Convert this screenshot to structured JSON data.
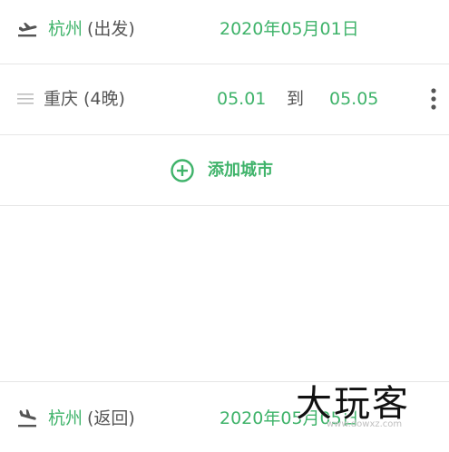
{
  "departure": {
    "city": "杭州",
    "tag": "(出发)",
    "date": "2020年05月01日"
  },
  "stop": {
    "city": "重庆",
    "nights": "(4晚)",
    "start": "05.01",
    "to": "到",
    "end": "05.05"
  },
  "add_city": {
    "label": "添加城市"
  },
  "return_trip": {
    "city": "杭州",
    "tag": "(返回)",
    "date": "2020年05月05日"
  },
  "watermark": {
    "logo_text": "大玩客",
    "small_text": "www.dowxz.com"
  },
  "colors": {
    "accent": "#3fb36a",
    "text": "#555555",
    "divider": "#e6e6e6"
  },
  "icons": {
    "departure": "plane-takeoff-icon",
    "stop_handle": "drag-handle-icon",
    "stop_more": "more-vertical-icon",
    "add": "add-circle-icon",
    "return": "plane-landing-icon"
  }
}
